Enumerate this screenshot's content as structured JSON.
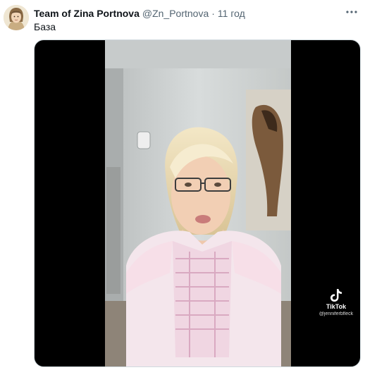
{
  "author": {
    "name": "Team of Zina Portnova",
    "handle": "@Zn_Portnova",
    "separator": "·",
    "time": "11 год"
  },
  "tweet": {
    "text": "База"
  },
  "media": {
    "kind": "video",
    "watermark": {
      "brand": "TikTok",
      "username": "@jenniferbfleck"
    }
  },
  "icons": {
    "more": "more-horizontal-icon",
    "watermark": "tiktok-logo-icon"
  },
  "colors": {
    "text_primary": "#0f1419",
    "text_secondary": "#536471",
    "border": "#cfd9de"
  }
}
